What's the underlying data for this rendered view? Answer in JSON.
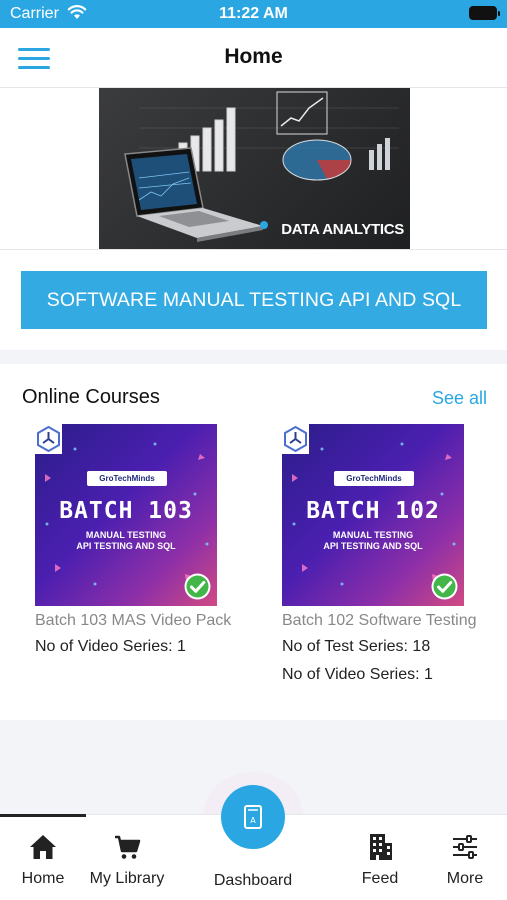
{
  "status_bar": {
    "carrier": "Carrier",
    "time": "11:22 AM"
  },
  "header": {
    "title": "Home"
  },
  "banner": {
    "caption": "DATA ANALYTICS"
  },
  "featured_course": {
    "label": "SOFTWARE MANUAL TESTING API AND SQL"
  },
  "online_courses": {
    "title": "Online Courses",
    "see_all": "See all",
    "items": [
      {
        "brand": "GroTechMinds",
        "batch": "BATCH 103",
        "subtitle_1": "MANUAL TESTING",
        "subtitle_2": "API TESTING AND SQL",
        "title": "Batch 103 MAS Video Pack",
        "meta": [
          "No of Video Series: 1"
        ]
      },
      {
        "brand": "GroTechMinds",
        "batch": "BATCH 102",
        "subtitle_1": "MANUAL TESTING",
        "subtitle_2": "API TESTING AND SQL",
        "title": "Batch 102 Software Testing",
        "meta": [
          "No of Test Series: 18",
          "No of Video Series: 1"
        ]
      }
    ]
  },
  "tab_bar": {
    "home": "Home",
    "library": "My Library",
    "dashboard": "Dashboard",
    "feed": "Feed",
    "more": "More"
  },
  "colors": {
    "accent": "#2aa7e3",
    "button": "#34aae3"
  },
  "icons": [
    "wifi-icon",
    "battery-icon",
    "hamburger-icon",
    "logo-icon",
    "check-icon",
    "home-icon",
    "cart-icon",
    "book-icon",
    "building-icon",
    "sliders-icon"
  ]
}
